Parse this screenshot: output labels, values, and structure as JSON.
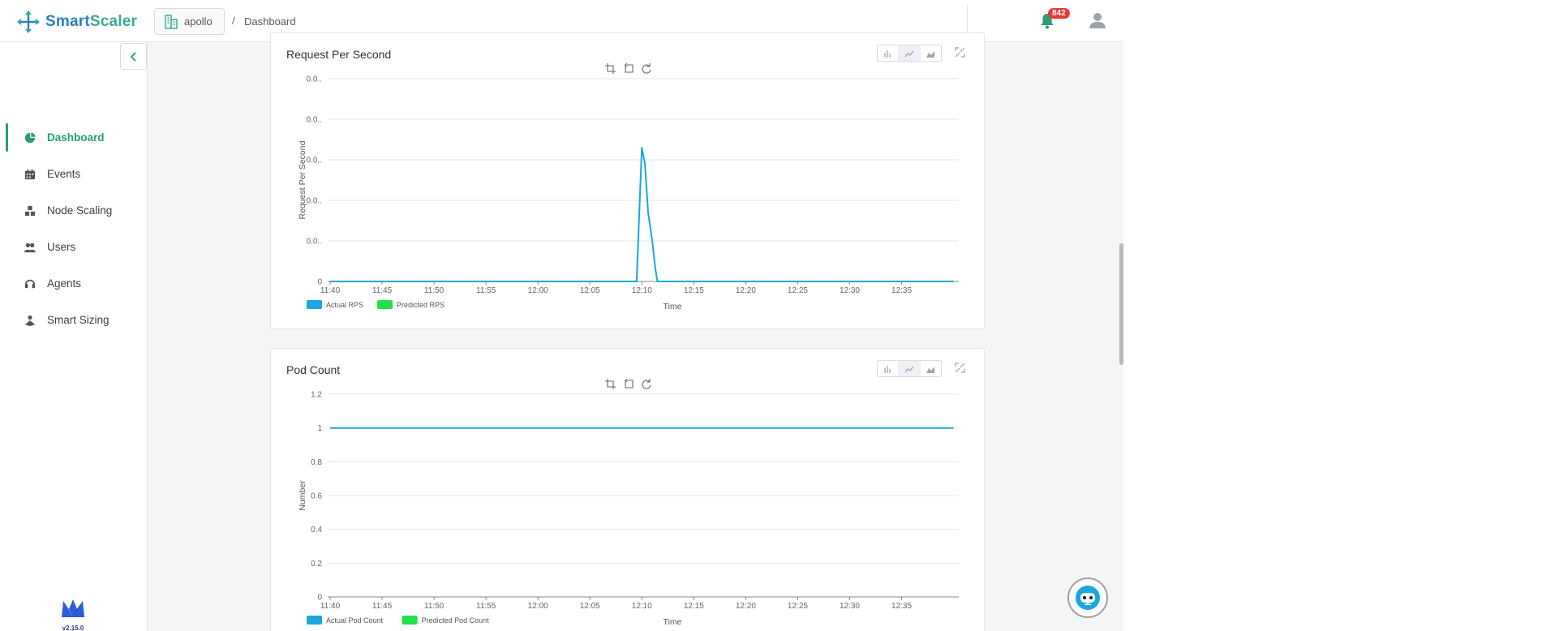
{
  "brand": {
    "name_part1": "Smart",
    "name_part2": "Scaler"
  },
  "header": {
    "cluster_label": "apollo",
    "breadcrumb_sep": "/",
    "breadcrumb": "Dashboard",
    "notification_count": "842"
  },
  "sidebar": {
    "items": [
      {
        "label": "Dashboard",
        "icon": "pie-chart-icon",
        "active": true
      },
      {
        "label": "Events",
        "icon": "calendar-icon",
        "active": false
      },
      {
        "label": "Node Scaling",
        "icon": "cubes-icon",
        "active": false
      },
      {
        "label": "Users",
        "icon": "users-icon",
        "active": false
      },
      {
        "label": "Agents",
        "icon": "headset-icon",
        "active": false
      },
      {
        "label": "Smart Sizing",
        "icon": "sizing-icon",
        "active": false
      }
    ],
    "version": "v2.15.0"
  },
  "colors": {
    "accent": "#2a9d72",
    "actual": "#1aa7dc",
    "predicted": "#22e048",
    "badge": "#e53935"
  },
  "chart_data": [
    {
      "type": "line",
      "title": "Request Per Second",
      "xlabel": "Time",
      "ylabel": "Request Per Second",
      "x_ticks": [
        "11:40",
        "11:45",
        "11:50",
        "11:55",
        "12:00",
        "12:05",
        "12:10",
        "12:15",
        "12:20",
        "12:25",
        "12:30",
        "12:35"
      ],
      "y_ticks": [
        "0",
        "0.0..",
        "0.0..",
        "0.0..",
        "0.0..",
        "0.0.."
      ],
      "ylim": [
        0,
        0.05
      ],
      "grid": true,
      "legend_placement": "bottom-left",
      "series": [
        {
          "name": "Actual RPS",
          "color": "#1aa7dc",
          "points": [
            [
              0,
              0
            ],
            [
              29.5,
              0
            ],
            [
              29.8,
              0.02
            ],
            [
              30.0,
              0.033
            ],
            [
              30.3,
              0.029
            ],
            [
              30.6,
              0.017
            ],
            [
              31.0,
              0.01
            ],
            [
              31.3,
              0.003
            ],
            [
              31.5,
              0
            ],
            [
              60,
              0
            ]
          ]
        },
        {
          "name": "Predicted RPS",
          "color": "#22e048",
          "points": []
        }
      ]
    },
    {
      "type": "line",
      "title": "Pod Count",
      "xlabel": "Time",
      "ylabel": "Number",
      "x_ticks": [
        "11:40",
        "11:45",
        "11:50",
        "11:55",
        "12:00",
        "12:05",
        "12:10",
        "12:15",
        "12:20",
        "12:25",
        "12:30",
        "12:35"
      ],
      "y_ticks": [
        "0",
        "0.2",
        "0.4",
        "0.6",
        "0.8",
        "1",
        "1.2"
      ],
      "ylim": [
        0,
        1.2
      ],
      "grid": true,
      "legend_placement": "bottom-left",
      "series": [
        {
          "name": "Actual Pod Count",
          "color": "#1aa7dc",
          "points": [
            [
              0,
              1
            ],
            [
              60,
              1
            ]
          ]
        },
        {
          "name": "Predicted Pod Count",
          "color": "#22e048",
          "points": []
        }
      ]
    }
  ]
}
